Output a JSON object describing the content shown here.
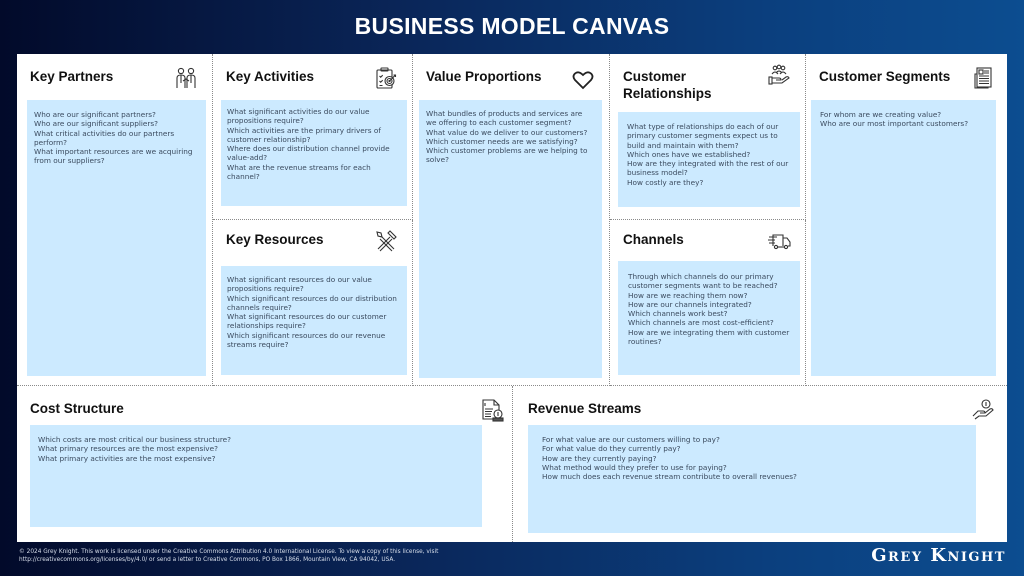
{
  "header": {
    "title": "BUSINESS MODEL CANVAS"
  },
  "blocks": {
    "key_partners": {
      "title": "Key Partners",
      "icon": "handshake-partners-icon",
      "questions": [
        "Who are our significant partners?",
        "Who are our significant suppliers?",
        "What critical activities do our partners perform?",
        "What important resources are we acquiring from our suppliers?"
      ]
    },
    "key_activities": {
      "title": "Key Activities",
      "icon": "clipboard-target-icon",
      "questions": [
        "What significant activities do our value propositions require?",
        "Which activities are the primary drivers of customer relationship?",
        "Where does our distribution channel provide value-add?",
        "What are the revenue streams for each channel?"
      ]
    },
    "key_resources": {
      "title": "Key Resources",
      "icon": "tools-icon",
      "questions": [
        "What significant resources do our value propositions require?",
        "Which significant resources do our distribution channels require?",
        "What significant resources do our customer relationships require?",
        "Which significant resources do our revenue streams require?"
      ]
    },
    "value_propositions": {
      "title": "Value Proportions",
      "icon": "heart-icon",
      "questions": [
        "What bundles of products and services are we offering to each customer segment?",
        "What value do we deliver to our customers?",
        "Which customer needs are we satisfying?",
        "Which customer problems are we helping to solve?"
      ]
    },
    "customer_relationships": {
      "title": "Customer Relationships",
      "icon": "hand-people-icon",
      "questions": [
        "What type of relationships do each of our primary customer segments expect us to build and maintain with them?",
        "Which ones have we established?",
        "How are they integrated with the rest of our business model?",
        "How costly are they?"
      ]
    },
    "channels": {
      "title": "Channels",
      "icon": "delivery-truck-icon",
      "questions": [
        "Through which channels do our primary customer segments want to be reached?",
        "How are we reaching them now?",
        "How are our channels integrated?",
        "Which channels work best?",
        "Which channels are most cost-efficient?",
        "How are we integrating them with customer routines?"
      ]
    },
    "customer_segments": {
      "title": "Customer Segments",
      "icon": "profile-document-icon",
      "questions": [
        "For whom are we creating value?",
        "Who are our most important customers?"
      ]
    },
    "cost_structure": {
      "title": "Cost Structure",
      "icon": "invoice-coins-icon",
      "questions": [
        "Which costs are most critical our business structure?",
        "What primary resources are the most expensive?",
        "What primary activities are the most expensive?"
      ]
    },
    "revenue_streams": {
      "title": "Revenue Streams",
      "icon": "hand-coin-icon",
      "questions": [
        "For what value are our customers willing to pay?",
        "For what value do they currently pay?",
        "How are they currently paying?",
        "What method would they prefer to use for paying?",
        "How much does each revenue stream contribute to overall revenues?"
      ]
    }
  },
  "footer": {
    "license_line1": "© 2024 Grey Knight. This work is licensed under the Creative Commons Attribution 4.0 International License. To view a copy of this license, visit",
    "license_line2": "http://creativecommons.org/licenses/by/4.0/ or send a letter to Creative Commons, PO Box 1866, Mountain View, CA 94042, USA.",
    "brand": "Grey Knight"
  },
  "colors": {
    "question_box": "#cceaff",
    "question_text": "#3a4a5e",
    "background_dark": "#020a2a",
    "background_blue": "#0c4d90"
  }
}
